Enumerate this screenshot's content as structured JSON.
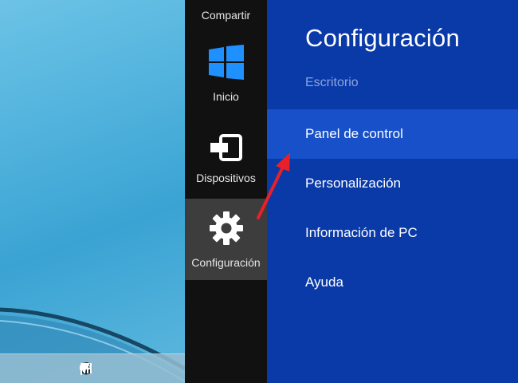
{
  "charms": [
    {
      "label": "Compartir",
      "icon": "share-icon"
    },
    {
      "label": "Inicio",
      "icon": "windows-logo-icon"
    },
    {
      "label": "Dispositivos",
      "icon": "devices-icon"
    },
    {
      "label": "Configuración",
      "icon": "gear-icon"
    }
  ],
  "settings": {
    "title": "Configuración",
    "section": "Escritorio",
    "items": [
      {
        "label": "Panel de control"
      },
      {
        "label": "Personalización"
      },
      {
        "label": "Información de PC"
      },
      {
        "label": "Ayuda"
      }
    ]
  },
  "colors": {
    "settings_bg": "#0a3aa8",
    "highlight_bg": "#1750c8",
    "charms_bg": "#111111",
    "active_charm_bg": "#3d3d3d",
    "windows_logo": "#1e90ff",
    "arrow": "#e8202a"
  },
  "tray_icons": [
    "onedrive-icon",
    "store-icon",
    "steam-icon",
    "flag-icon",
    "signal-icon",
    "volume-icon"
  ]
}
